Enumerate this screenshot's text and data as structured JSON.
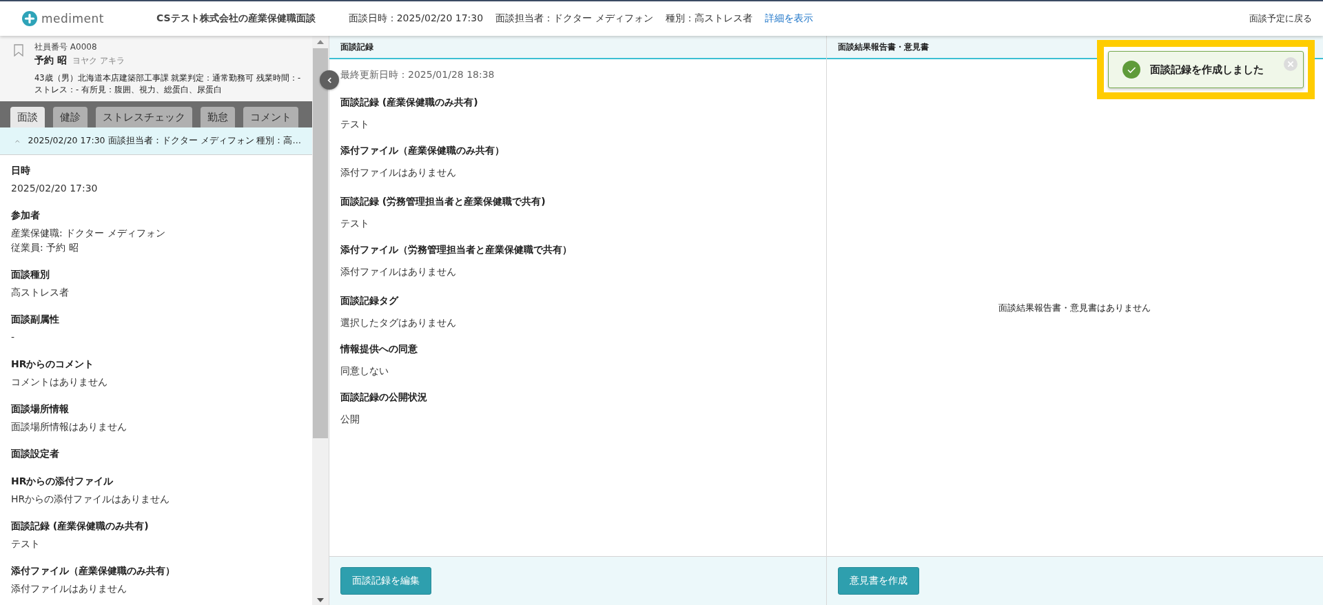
{
  "header": {
    "logo": "mediment",
    "title": "CSテスト株式会社の産業保健職面談",
    "info": [
      "面談日時：2025/02/20 17:30",
      "面談担当者：ドクター メディフォン",
      "種別：高ストレス者"
    ],
    "details_link": "詳細を表示",
    "back_link": "面談予定に戻る"
  },
  "employee": {
    "bookmarked": false,
    "number": "社員番号 A0008",
    "name": "予約 昭",
    "kana": "ヨヤク アキラ",
    "summary": "43歳（男）北海道本店建築部工事課  就業判定：通常勤務可  残業時間：-  ストレス：-  有所見：腹囲、視力、総蛋白、尿蛋白"
  },
  "tabs": [
    {
      "label": "面談",
      "selected": true
    },
    {
      "label": "健診",
      "selected": false
    },
    {
      "label": "ストレスチェック",
      "selected": false
    },
    {
      "label": "勤怠",
      "selected": false
    },
    {
      "label": "コメント",
      "selected": false
    }
  ],
  "accordion": {
    "expanded": true,
    "summary": "2025/02/20 17:30  面談担当者：ドクター メディフォン  種別：高…"
  },
  "fields": [
    {
      "label": "日時",
      "lines": [
        "2025/02/20 17:30"
      ]
    },
    {
      "label": "参加者",
      "lines": [
        "産業保健職: ドクター メディフォン",
        "従業員: 予約 昭"
      ]
    },
    {
      "label": "面談種別",
      "lines": [
        "高ストレス者"
      ]
    },
    {
      "label": "面談副属性",
      "lines": [
        "-"
      ]
    },
    {
      "label": "HRからのコメント",
      "lines": [
        "コメントはありません"
      ]
    },
    {
      "label": "面談場所情報",
      "lines": [
        "面談場所情報はありません"
      ]
    },
    {
      "label": "面談設定者"
    },
    {
      "label": "HRからの添付ファイル",
      "lines": [
        "HRからの添付ファイルはありません"
      ]
    },
    {
      "label": "面談記録 (産業保健職のみ共有)",
      "lines": [
        "テスト"
      ]
    },
    {
      "label": "添付ファイル（産業保健職のみ共有）",
      "lines": [
        "添付ファイルはありません"
      ]
    }
  ],
  "record": {
    "heading": "面談記録",
    "updated": "最終更新日時：2025/01/28 18:38",
    "groups": [
      [
        {
          "label": "面談記録 (産業保健職のみ共有)",
          "value": "テスト"
        },
        {
          "label": "添付ファイル（産業保健職のみ共有）",
          "value": "添付ファイルはありません"
        }
      ],
      [
        {
          "label": "面談記録 (労務管理担当者と産業保健職で共有)",
          "value": "テスト"
        },
        {
          "label": "添付ファイル（労務管理担当者と産業保健職で共有）",
          "value": "添付ファイルはありません"
        }
      ],
      [
        {
          "label": "面談記録タグ",
          "value": "選択したタグはありません"
        },
        {
          "label": "情報提供への同意",
          "value": "同意しない"
        },
        {
          "label": "面談記録の公開状況",
          "value": "公開"
        }
      ]
    ],
    "button": "面談記録を編集"
  },
  "report": {
    "heading": "面談結果報告書・意見書",
    "empty": "面談結果報告書・意見書はありません",
    "button": "意見書を作成"
  },
  "toast": {
    "message": "面談記録を作成しました"
  }
}
